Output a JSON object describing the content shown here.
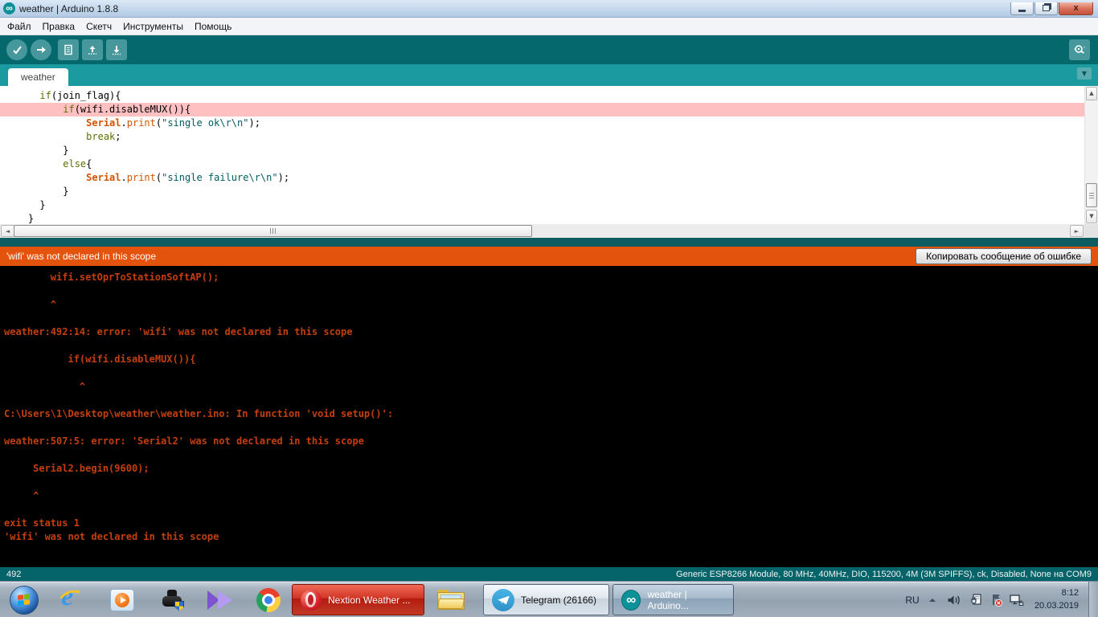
{
  "palette": {
    "toolbar_teal": "#05686d",
    "tabstrip_teal": "#1b9ba0",
    "toolbar_button_teal": "#46989c",
    "error_banner_orange": "#e4530b",
    "console_background": "#000000",
    "console_text_red": "#c33f0e",
    "error_line_highlight_pink": "#ffc0c1",
    "status_bar_teal": "#04646a",
    "keyword_green": "#5e6d03",
    "function_orange": "#d35400",
    "string_teal": "#005c5f"
  },
  "icons": {
    "app": "arduino-infinity",
    "toolbar": [
      "verify-check",
      "upload-arrow",
      "new-document",
      "open-up-arrow",
      "save-down-arrow",
      "serial-monitor-magnifier"
    ],
    "taskbar": [
      "windows-start-orb",
      "internet-explorer",
      "windows-media-player",
      "device-driver-with-uac-shield",
      "kmplayer",
      "chrome",
      "opera",
      "explorer-folder",
      "telegram",
      "arduino-infinity"
    ],
    "tray": [
      "hidden-icons-arrow",
      "speaker",
      "safely-remove-hardware",
      "action-center-flag-error",
      "network-status"
    ]
  },
  "window": {
    "title": "weather | Arduino 1.8.8"
  },
  "menubar": {
    "items": [
      {
        "label": "Файл"
      },
      {
        "label": "Правка"
      },
      {
        "label": "Скетч"
      },
      {
        "label": "Инструменты"
      },
      {
        "label": "Помощь"
      }
    ]
  },
  "tabstrip": {
    "active_tab": "weather"
  },
  "editor": {
    "lines": [
      {
        "hl": false,
        "tokens": [
          [
            "pl",
            "      "
          ],
          [
            "kw",
            "if"
          ],
          [
            "pl",
            "(join_flag){"
          ]
        ]
      },
      {
        "hl": true,
        "tokens": [
          [
            "pl",
            "          "
          ],
          [
            "kw",
            "if"
          ],
          [
            "pl",
            "(wifi.disableMUX()){"
          ]
        ]
      },
      {
        "hl": false,
        "tokens": [
          [
            "pl",
            "              "
          ],
          [
            "fnb",
            "Serial"
          ],
          [
            "pl",
            "."
          ],
          [
            "fn",
            "print"
          ],
          [
            "pl",
            "("
          ],
          [
            "str",
            "\"single ok\\r\\n\""
          ],
          [
            "pl",
            ");"
          ]
        ]
      },
      {
        "hl": false,
        "tokens": [
          [
            "pl",
            "              "
          ],
          [
            "kw",
            "break"
          ],
          [
            "pl",
            ";"
          ]
        ]
      },
      {
        "hl": false,
        "tokens": [
          [
            "pl",
            "          }"
          ]
        ]
      },
      {
        "hl": false,
        "tokens": [
          [
            "pl",
            "          "
          ],
          [
            "kw",
            "else"
          ],
          [
            "pl",
            "{"
          ]
        ]
      },
      {
        "hl": false,
        "tokens": [
          [
            "pl",
            "              "
          ],
          [
            "fnb",
            "Serial"
          ],
          [
            "pl",
            "."
          ],
          [
            "fn",
            "print"
          ],
          [
            "pl",
            "("
          ],
          [
            "str",
            "\"single failure\\r\\n\""
          ],
          [
            "pl",
            ");"
          ]
        ]
      },
      {
        "hl": false,
        "tokens": [
          [
            "pl",
            "          }"
          ]
        ]
      },
      {
        "hl": false,
        "tokens": [
          [
            "pl",
            "      }"
          ]
        ]
      },
      {
        "hl": false,
        "tokens": [
          [
            "pl",
            "    }"
          ]
        ]
      }
    ]
  },
  "errorbar": {
    "message": "'wifi' was not declared in this scope",
    "copy_button": "Копировать сообщение об ошибке"
  },
  "console": {
    "lines": [
      "        wifi.setOprToStationSoftAP();",
      "",
      "        ^",
      "",
      "weather:492:14: error: 'wifi' was not declared in this scope",
      "",
      "           if(wifi.disableMUX()){",
      "",
      "             ^",
      "",
      "C:\\Users\\1\\Desktop\\weather\\weather.ino: In function 'void setup()':",
      "",
      "weather:507:5: error: 'Serial2' was not declared in this scope",
      "",
      "     Serial2.begin(9600);",
      "",
      "     ^",
      "",
      "exit status 1",
      "'wifi' was not declared in this scope"
    ]
  },
  "statusbar": {
    "line_number": "492",
    "board_info": "Generic ESP8266 Module, 80 MHz, 40MHz, DIO, 115200, 4M (3M SPIFFS), ck, Disabled, None на COM9"
  },
  "taskbar": {
    "buttons": {
      "nextion": {
        "label": "Nextion Weather ..."
      },
      "telegram": {
        "label": "Telegram (26166)"
      },
      "arduino": {
        "label": "weather | Arduino..."
      }
    },
    "tray": {
      "language": "RU",
      "time": "8:12",
      "date": "20.03.2019"
    }
  }
}
